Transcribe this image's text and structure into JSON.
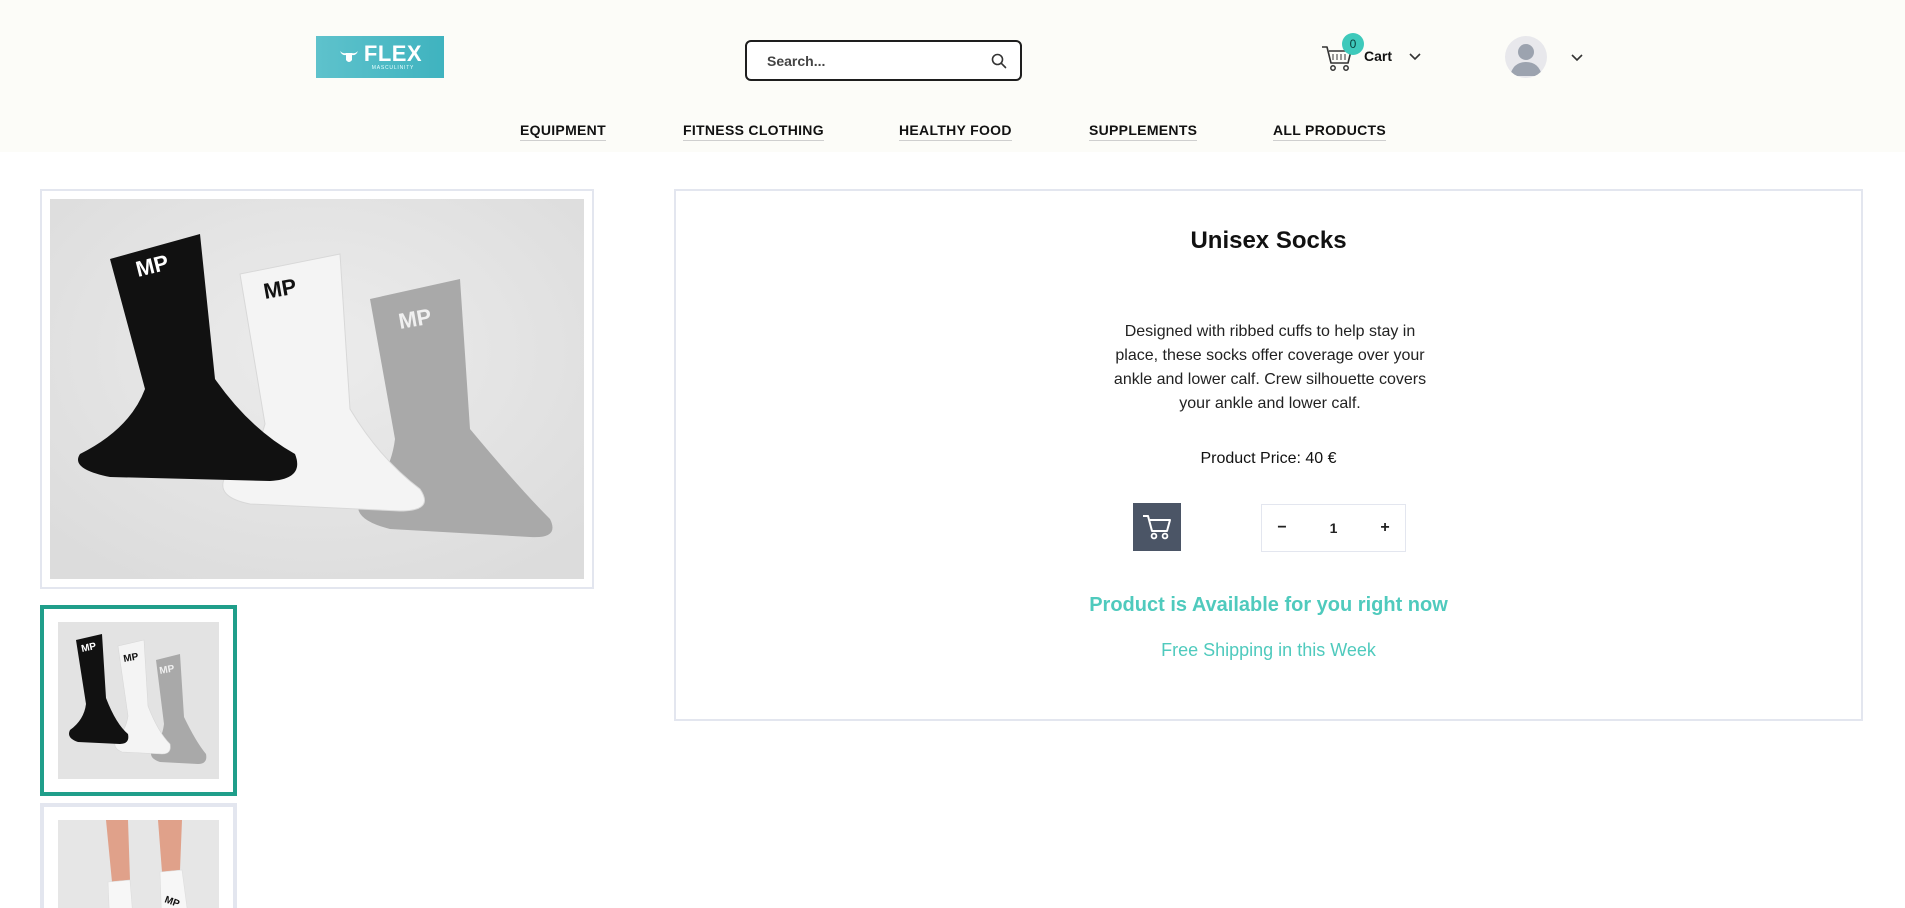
{
  "brand": {
    "logo_text": "FLEX",
    "logo_subtext": "MASCULINITY",
    "accent_color": "#3fb3bf"
  },
  "search": {
    "placeholder": "Search...",
    "icon": "search-icon"
  },
  "cart": {
    "count": "0",
    "label": "Cart",
    "icon": "shopping-cart-icon"
  },
  "user": {
    "avatar_icon": "user-avatar-icon"
  },
  "nav": {
    "items": [
      {
        "label": "EQUIPMENT"
      },
      {
        "label": "FITNESS CLOTHING"
      },
      {
        "label": "HEALTHY FOOD"
      },
      {
        "label": "SUPPLEMENTS"
      },
      {
        "label": "ALL PRODUCTS"
      }
    ]
  },
  "gallery": {
    "selected_thumb_border_color": "#1f9e8a"
  },
  "product": {
    "title": "Unisex Socks",
    "description": "Designed with ribbed cuffs to help stay in place, these socks offer coverage over your ankle and lower calf. Crew silhouette covers your ankle and lower calf.",
    "price_text": "Product Price: 40 €",
    "quantity": "1",
    "decrement_label": "−",
    "increment_label": "+",
    "availability": "Product is Available for you right now",
    "shipping": "Free Shipping in this Week",
    "status_color": "#4fcabd",
    "button_color": "#4b5566"
  }
}
